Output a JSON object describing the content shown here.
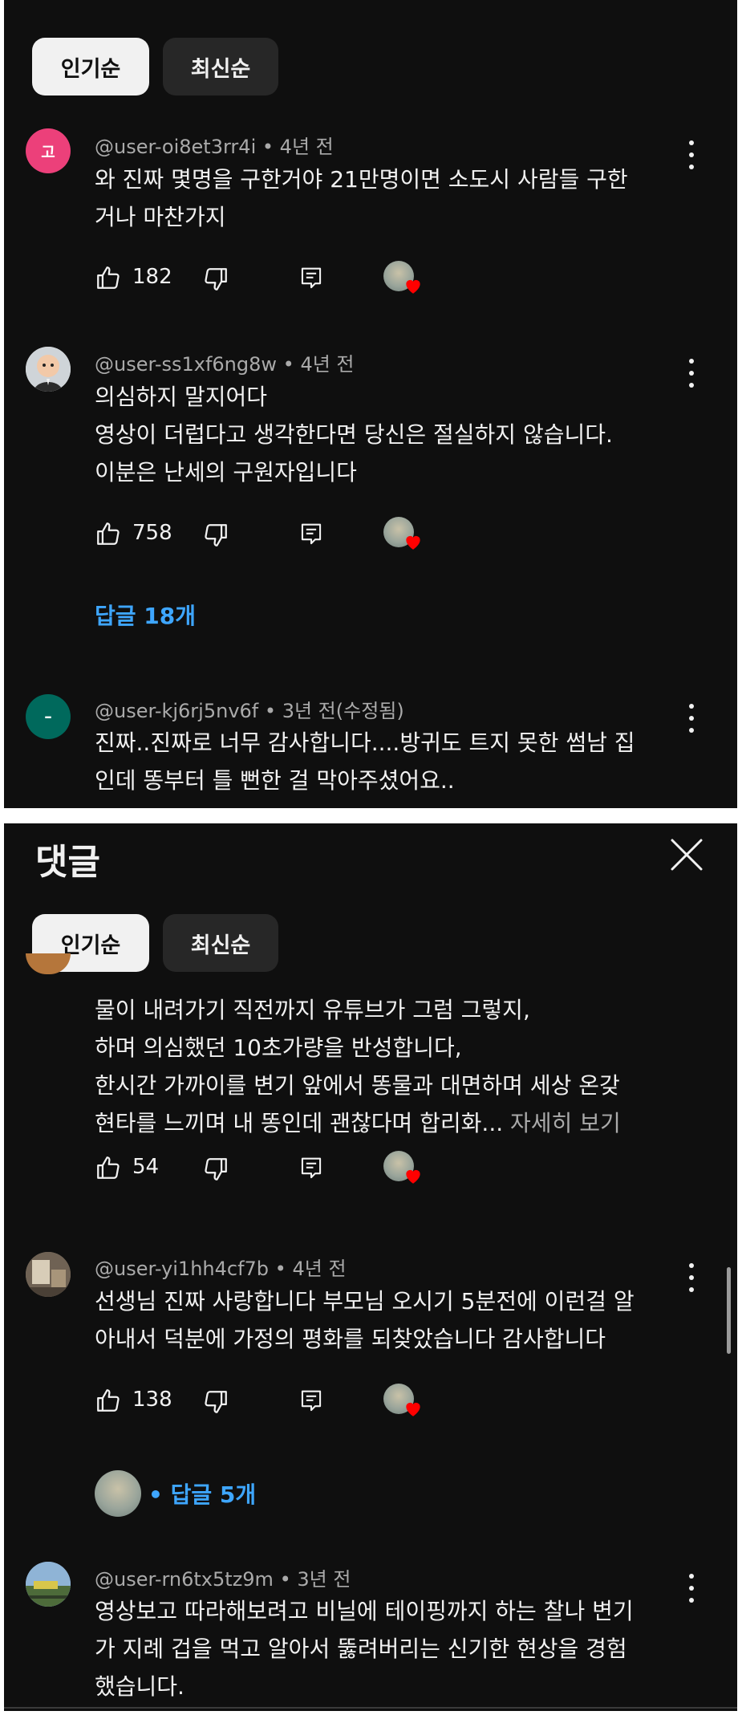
{
  "sort_chips": {
    "popular": "인기순",
    "newest": "최신순"
  },
  "sheet": {
    "title": "댓글"
  },
  "icons": {
    "like": "thumb-up-icon",
    "dislike": "thumb-down-icon",
    "reply": "reply-icon",
    "more": "more-vert-icon",
    "close": "close-icon",
    "creator_heart": "creator-heart-icon"
  },
  "colors": {
    "background": "#0f0f0f",
    "link": "#3ea6ff",
    "chip_active": "#f1f1f1",
    "chip_inactive": "#272727",
    "heart": "#ff0000"
  },
  "panel1": {
    "comments": [
      {
        "avatar_letter": "고",
        "avatar_color": "#ec407a",
        "author": "@user-oi8et3rr4i",
        "time": "4년 전",
        "lines": [
          "와 진짜 몇명을 구한거야 21만명이면 소도시 사람들 구한",
          "거나 마찬가지"
        ],
        "likes": "182"
      },
      {
        "author": "@user-ss1xf6ng8w",
        "time": "4년 전",
        "lines": [
          "의심하지 말지어다",
          "영상이 더럽다고 생각한다면 당신은 절실하지 않습니다.",
          "이분은 난세의 구원자입니다"
        ],
        "likes": "758",
        "replies": "답글 18개"
      },
      {
        "avatar_letter": "–",
        "avatar_color": "#00695c",
        "author": "@user-kj6rj5nv6f",
        "time": "3년 전(수정됨)",
        "lines": [
          "진짜..진짜로 너무 감사합니다....방귀도 트지 못한 썸남 집",
          "인데 똥부터 틀 뻔한 걸 막아주셨어요.."
        ]
      }
    ]
  },
  "panel2": {
    "comments": [
      {
        "lines": [
          "물이 내려가기 직전까지 유튜브가 그럼 그렇지,",
          "하며 의심했던 10초가량을 반성합니다,",
          "한시간 가까이를 변기 앞에서 똥물과 대면하며 세상 온갖",
          "현타를 느끼며 내 똥인데 괜찮다며 합리화..."
        ],
        "read_more": "자세히 보기",
        "likes": "54"
      },
      {
        "author": "@user-yi1hh4cf7b",
        "time": "4년 전",
        "lines": [
          "선생님 진짜 사랑합니다 부모님 오시기 5분전에 이런걸 알",
          "아내서 덕분에 가정의 평화를 되찾았습니다 감사합니다"
        ],
        "likes": "138",
        "replies": "답글 5개"
      },
      {
        "author": "@user-rn6tx5tz9m",
        "time": "3년 전",
        "lines": [
          "영상보고 따라해보려고 비닐에 테이핑까지 하는 찰나 변기",
          "가 지례 겁을 먹고 알아서 뚫려버리는 신기한 현상을 경험",
          "했습니다."
        ]
      }
    ]
  },
  "separator": "•"
}
